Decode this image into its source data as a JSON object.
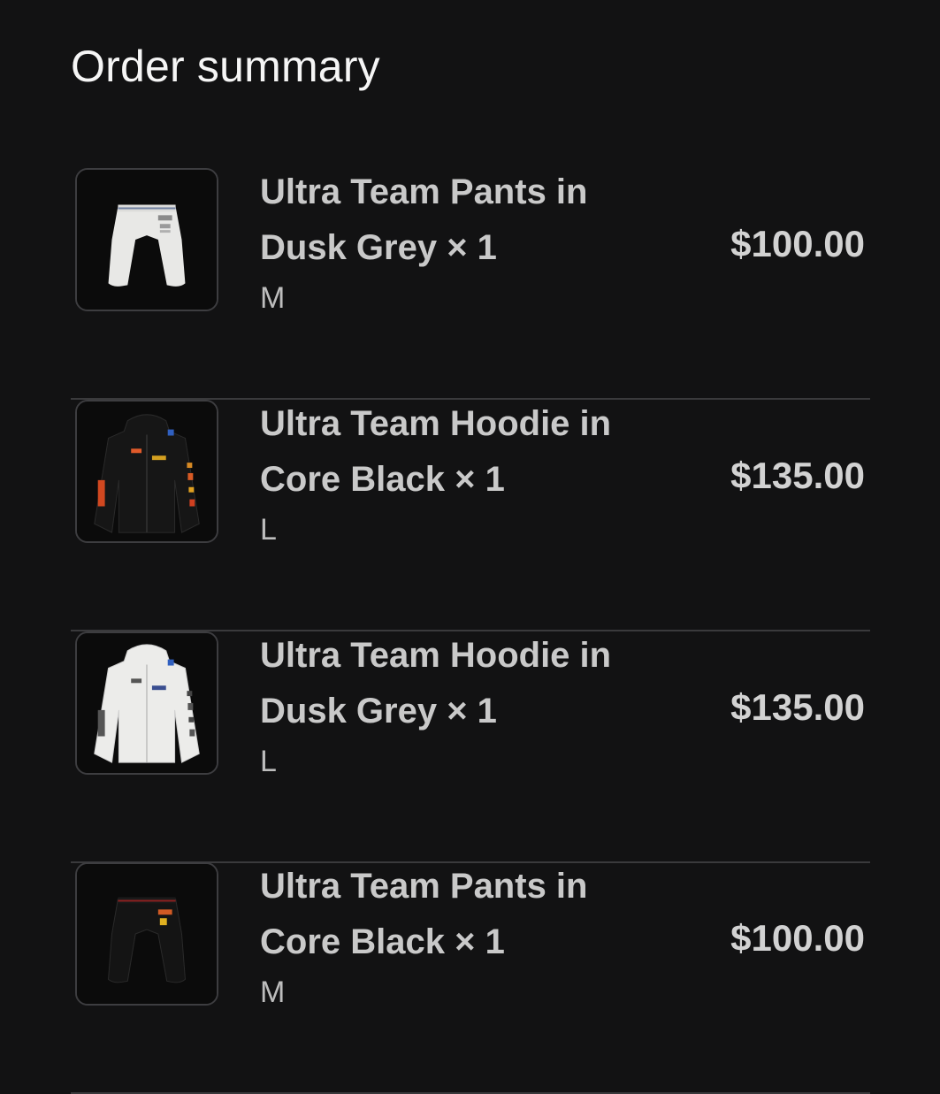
{
  "header": {
    "title": "Order summary"
  },
  "items": [
    {
      "name_line1": "Ultra Team Pants in",
      "name_line2": "Dusk Grey × 1",
      "variant": "M",
      "price": "$100.00",
      "image": "grey-pants-image"
    },
    {
      "name_line1": "Ultra Team Hoodie in",
      "name_line2": "Core Black × 1",
      "variant": "L",
      "price": "$135.00",
      "image": "black-hoodie-image"
    },
    {
      "name_line1": "Ultra Team Hoodie in",
      "name_line2": "Dusk Grey × 1",
      "variant": "L",
      "price": "$135.00",
      "image": "grey-hoodie-image"
    },
    {
      "name_line1": "Ultra Team Pants in",
      "name_line2": "Core Black × 1",
      "variant": "M",
      "price": "$100.00",
      "image": "black-pants-image"
    }
  ]
}
